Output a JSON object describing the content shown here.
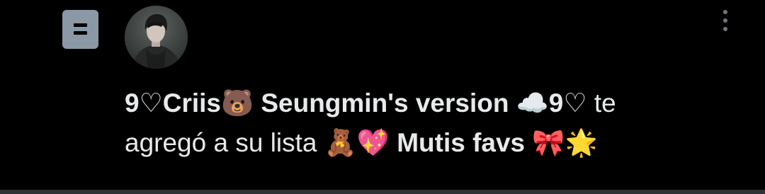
{
  "notification": {
    "user_display_name": "9♡Criis🐻 Seungmin's version ☁️9♡",
    "action_text_line1_tail": " te",
    "action_text_line2": "agregó a su lista 🧸💖 ",
    "list_name": "Mutis favs 🎀🌟"
  },
  "icons": {
    "list": "list-icon",
    "more": "more-options-icon"
  },
  "colors": {
    "background": "#000000",
    "text": "#e7e9ea",
    "icon_gray": "#8b98a5",
    "muted": "#71767b",
    "divider": "#2f3336"
  }
}
